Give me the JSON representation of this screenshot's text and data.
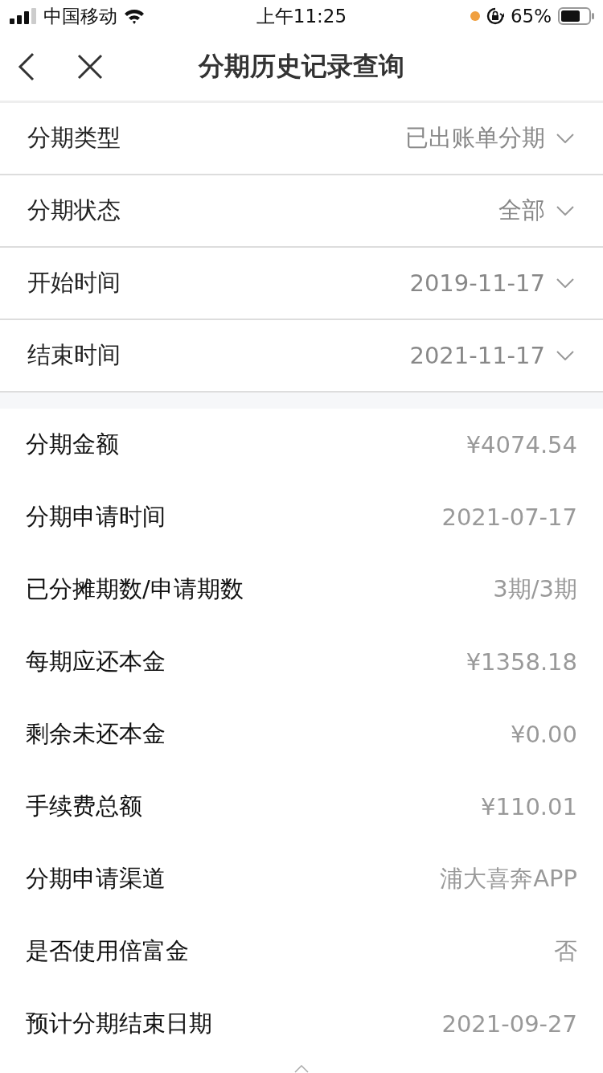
{
  "status_bar": {
    "carrier": "中国移动",
    "time": "上午11:25",
    "battery": "65%"
  },
  "nav": {
    "title": "分期历史记录查询"
  },
  "filters": [
    {
      "label": "分期类型",
      "value": "已出账单分期"
    },
    {
      "label": "分期状态",
      "value": "全部"
    },
    {
      "label": "开始时间",
      "value": "2019-11-17"
    },
    {
      "label": "结束时间",
      "value": "2021-11-17"
    }
  ],
  "details": [
    {
      "label": "分期金额",
      "value": "¥4074.54"
    },
    {
      "label": "分期申请时间",
      "value": "2021-07-17"
    },
    {
      "label": "已分摊期数/申请期数",
      "value": "3期/3期"
    },
    {
      "label": "每期应还本金",
      "value": "¥1358.18"
    },
    {
      "label": "剩余未还本金",
      "value": "¥0.00"
    },
    {
      "label": "手续费总额",
      "value": "¥110.01"
    },
    {
      "label": "分期申请渠道",
      "value": "浦大喜奔APP"
    },
    {
      "label": "是否使用倍富金",
      "value": "否"
    },
    {
      "label": "预计分期结束日期",
      "value": "2021-09-27"
    }
  ]
}
